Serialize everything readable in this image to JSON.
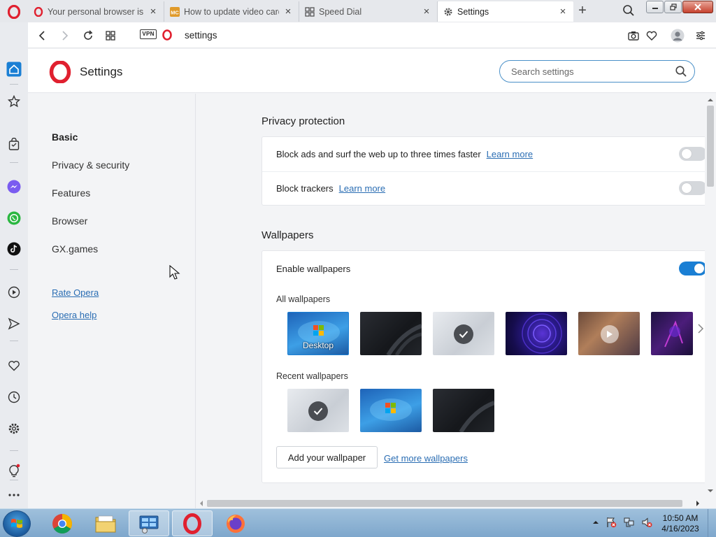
{
  "tabs": [
    {
      "title": "Your personal browser is a",
      "favicon": "opera-icon"
    },
    {
      "title": "How to update video card",
      "favicon": "mc-icon"
    },
    {
      "title": "Speed Dial",
      "favicon": "speed-dial-icon"
    },
    {
      "title": "Settings",
      "favicon": "gear-icon",
      "active": true
    }
  ],
  "address": {
    "vpn_label": "VPN",
    "url": "settings"
  },
  "header": {
    "title": "Settings",
    "search_placeholder": "Search settings"
  },
  "nav": {
    "items": [
      "Basic",
      "Privacy & security",
      "Features",
      "Browser",
      "GX.games"
    ],
    "active": "Basic",
    "links": [
      "Rate Opera",
      "Opera help"
    ]
  },
  "privacy": {
    "title": "Privacy protection",
    "block_ads": {
      "label": "Block ads and surf the web up to three times faster",
      "link": "Learn more",
      "enabled": false
    },
    "block_trackers": {
      "label": "Block trackers",
      "link": "Learn more",
      "enabled": false
    }
  },
  "wallpapers": {
    "title": "Wallpapers",
    "enable_label": "Enable wallpapers",
    "enabled": true,
    "all_label": "All wallpapers",
    "recent_label": "Recent wallpapers",
    "desktop_caption": "Desktop",
    "add_button": "Add your wallpaper",
    "more_link": "Get more wallpapers"
  },
  "taskbar": {
    "time": "10:50 AM",
    "date": "4/16/2023"
  },
  "colors": {
    "accent": "#1a7fd4",
    "link": "#2a6db3",
    "opera_red": "#e0202f",
    "search_border": "#4a90c8"
  }
}
